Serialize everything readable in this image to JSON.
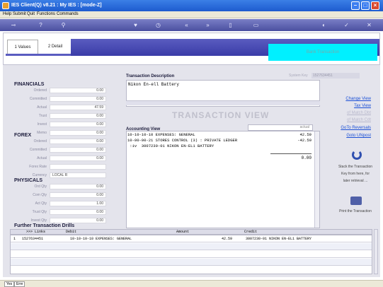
{
  "window": {
    "title": "IES Client(Q) v8.21 : My IES :     [mode-Z]",
    "controls": [
      "minimize-icon",
      "maximize-icon",
      "close-icon"
    ]
  },
  "menu": {
    "items": [
      "Help",
      "Submit",
      "Quit",
      "Functions",
      "Commands"
    ]
  },
  "toolbar": {
    "icons": [
      "key-icon",
      "help-icon",
      "search-icon",
      "heart-icon",
      "clock-icon",
      "rewind-icon",
      "fast-forward-icon",
      "stop-icon",
      "document-icon",
      "globe-icon",
      "check-icon",
      "close-icon"
    ]
  },
  "tabs": [
    {
      "label": "1 Values",
      "active": true
    },
    {
      "label": "2 Detail",
      "active": false
    }
  ],
  "header_box_text": "Bank Transaction",
  "financials": {
    "title": "FINANCIALS",
    "rows": [
      {
        "label": "Ordered",
        "value": "0.00"
      },
      {
        "label": "Committed",
        "value": "0.00"
      },
      {
        "label": "Actual",
        "value": "47.59"
      },
      {
        "label": "Trust",
        "value": "0.00"
      },
      {
        "label": "Invest",
        "value": "0.00"
      },
      {
        "label": "Memo",
        "value": "0.00"
      }
    ]
  },
  "forex": {
    "title": "FOREX",
    "rows": [
      {
        "label": "Ordered",
        "value": "0.00"
      },
      {
        "label": "Committed",
        "value": "0.00"
      },
      {
        "label": "Actual",
        "value": "0.00"
      },
      {
        "label": "Forex Rate",
        "value": ""
      },
      {
        "label": "Currency",
        "value": "LOCAL R"
      }
    ]
  },
  "physicals": {
    "title": "PHYSICALS",
    "rows": [
      {
        "label": "Ord Qty",
        "value": "0.00"
      },
      {
        "label": "Com Qty",
        "value": "0.00"
      },
      {
        "label": "Act Qty",
        "value": "1.00"
      },
      {
        "label": "Trust Qty",
        "value": "0.00"
      },
      {
        "label": "Invest Qty",
        "value": "0.00"
      }
    ]
  },
  "transaction": {
    "description_label": "Transaction Description",
    "description": "Nikon En-ell Battery",
    "sys_key_label": "System Key",
    "sys_key": "1527634451",
    "view_title": "TRANSACTION VIEW",
    "accounting_label": "Accounting View",
    "accounting_col": "actual",
    "lines": [
      {
        "text": "10-10-10-10 EXPENSES: GENERAL",
        "amount": "42.59"
      },
      {
        "text": "10-00-00-21 STORES CONTROL (3) : PRIVATE LEDGER",
        "amount": "-42.59"
      },
      {
        "text": " :iv  3007230-01 NIKON EN-EL1 BATTERY",
        "amount": ""
      }
    ],
    "total": "0.00"
  },
  "side_links": [
    {
      "label": "Change View",
      "dim": false
    },
    {
      "label": "Tax View",
      "dim": false
    },
    {
      "label": "of Match Dbt",
      "dim": true
    },
    {
      "label": "of Match Cdt",
      "dim": true
    },
    {
      "label": "GoTo Reversals",
      "dim": false
    },
    {
      "label": "Goto UNpost",
      "dim": false
    }
  ],
  "side_actions": {
    "stack_text": [
      "Stack the Transaction",
      "Key from here, for",
      "later retrieval ..."
    ],
    "print_text": "Print the Transaction"
  },
  "drills": {
    "title": "Further Transaction Drills",
    "headers": [
      ">>> Links",
      "Debit",
      "Amount",
      "Credit"
    ],
    "rows": [
      {
        "num": "1",
        "link": "1527634451",
        "debit": "10-10-10-10 EXPENSES: GENERAL",
        "amount": "42.59",
        "credit": "3007230-01 NIKON EN-EL1 BATTERY"
      }
    ]
  },
  "status": {
    "buttons": [
      "Yes",
      "Erre"
    ]
  }
}
